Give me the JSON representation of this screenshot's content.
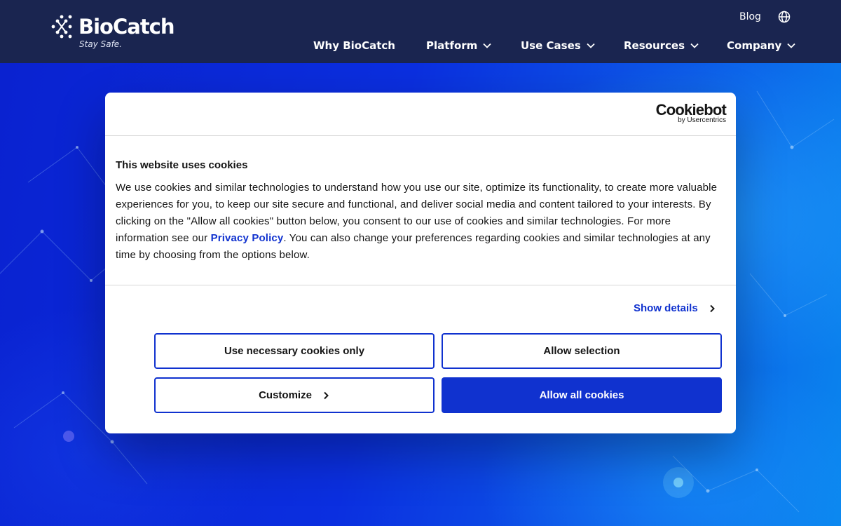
{
  "header": {
    "logo_text": "BioCatch",
    "logo_tagline": "Stay Safe.",
    "blog_label": "Blog",
    "globe_icon": "globe-icon",
    "nav": [
      {
        "label": "Why BioCatch",
        "has_dropdown": false
      },
      {
        "label": "Platform",
        "has_dropdown": true
      },
      {
        "label": "Use Cases",
        "has_dropdown": true
      },
      {
        "label": "Resources",
        "has_dropdown": true
      },
      {
        "label": "Company",
        "has_dropdown": true
      }
    ]
  },
  "cookie_dialog": {
    "brand": "Cookiebot",
    "brand_sub": "by Usercentrics",
    "title": "This website uses cookies",
    "body_before_link": "We use cookies and similar technologies to understand how you use our site, optimize its functionality, to create more valuable experiences for you, to keep our site secure and functional, and deliver social media and content tailored to your interests. By clicking on the \"Allow all cookies\" button below, you consent to our use of cookies and similar technologies. For more information see our ",
    "policy_link": "Privacy Policy",
    "body_after_link": ". You can also change your preferences regarding cookies and similar technologies at any time by choosing from the options below.",
    "show_details": "Show details",
    "buttons": {
      "necessary_only": "Use necessary cookies only",
      "allow_selection": "Allow selection",
      "customize": "Customize",
      "allow_all": "Allow all cookies"
    }
  },
  "colors": {
    "header_bg": "#1a2550",
    "accent_blue": "#1032cf",
    "hero_blue": "#0a2bd8"
  }
}
